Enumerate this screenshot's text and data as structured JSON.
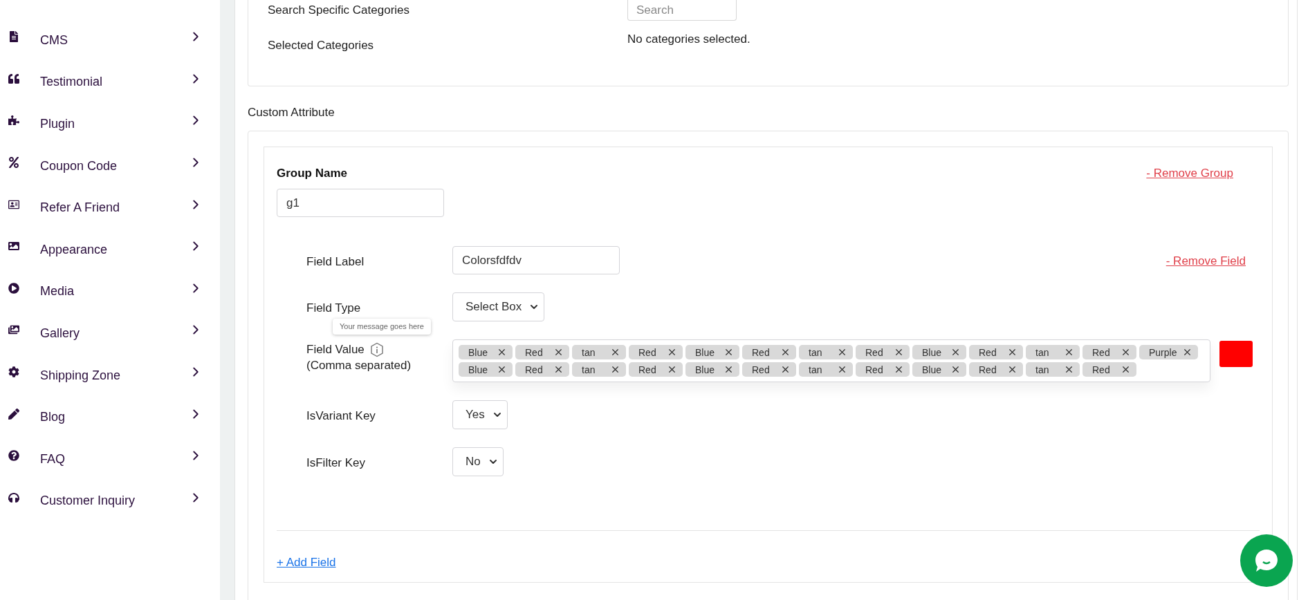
{
  "sidebar": {
    "items": [
      {
        "label": "CMS"
      },
      {
        "label": "Testimonial"
      },
      {
        "label": "Plugin"
      },
      {
        "label": "Coupon Code"
      },
      {
        "label": "Refer A Friend"
      },
      {
        "label": "Appearance"
      },
      {
        "label": "Media"
      },
      {
        "label": "Gallery"
      },
      {
        "label": "Shipping Zone"
      },
      {
        "label": "Blog"
      },
      {
        "label": "FAQ"
      },
      {
        "label": "Customer Inquiry"
      }
    ]
  },
  "categories": {
    "search_label": "Search Specific Categories",
    "search": {
      "placeholder": "Search"
    },
    "selected_label": "Selected Categories",
    "selected_value": "No categories selected."
  },
  "custom_attribute": {
    "title": "Custom Attribute",
    "group": {
      "name_label": "Group Name",
      "name_value": "g1",
      "remove_group": "- Remove Group",
      "field": {
        "remove_field": "- Remove Field",
        "label_label": "Field Label",
        "label_value": "Colorsfdfdv",
        "type_label": "Field Type",
        "type_value": "Select Box",
        "value_label": "Field Value",
        "value_hint": "(Comma separated)",
        "tooltip": "Your message goes here",
        "values": [
          "Blue",
          "Red",
          "tan",
          "Red",
          "Blue",
          "Red",
          "tan",
          "Red",
          "Blue",
          "Red",
          "tan",
          "Red",
          "Purple",
          "Blue",
          "Red",
          "tan",
          "Red",
          "Blue",
          "Red",
          "tan",
          "Red",
          "Blue",
          "Red",
          "tan",
          "Red"
        ],
        "variant_label": "IsVariant Key",
        "variant_value": "Yes",
        "filter_label": "IsFilter Key",
        "filter_value": "No"
      },
      "add_field": "+ Add Field"
    }
  }
}
